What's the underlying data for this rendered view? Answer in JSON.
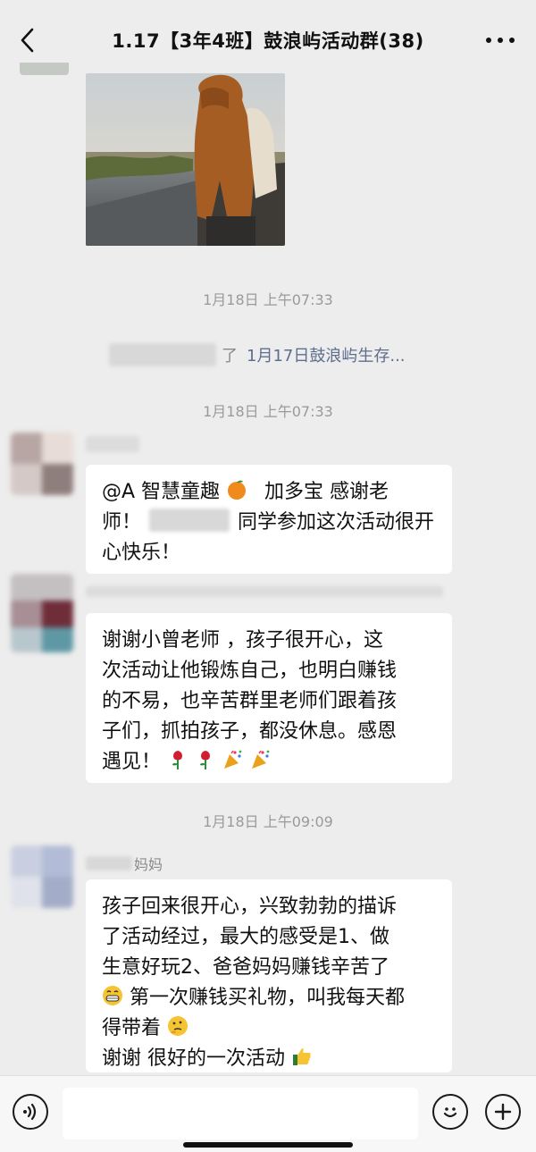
{
  "header": {
    "title": "1.17【3年4班】鼓浪屿活动群(38)"
  },
  "timestamps": [
    "1月18日  上午07:33",
    "1月18日  上午07:33",
    "1月18日  上午09:09"
  ],
  "system_message": {
    "text_visible": "了",
    "link_text": "1月17日鼓浪屿生存..."
  },
  "messages": [
    {
      "sender_visible": "",
      "lines": [
        "@A 智慧童趣",
        "加多宝  感谢老",
        "师！",
        "同学参加这次活动很开",
        "心快乐！"
      ],
      "emoji_after_first": "orange"
    },
    {
      "sender_visible": "",
      "lines": [
        "谢谢小曾老师 ，孩子很开心，这",
        "次活动让他锻炼自己，也明白赚钱",
        "的不易，也辛苦群里老师们跟着孩",
        "子们，抓拍孩子，都没休息。感恩",
        "遇见！"
      ],
      "emojis": [
        "rose",
        "rose",
        "party-popper",
        "party-popper"
      ]
    },
    {
      "sender_visible": "妈妈",
      "lines": [
        "孩子回来很开心，兴致勃勃的描诉",
        "了活动经过，最大的感受是1、做",
        "生意好玩2、爸爸妈妈赚钱辛苦了",
        "第一次赚钱买礼物，叫我每天都",
        "得带着",
        "谢谢  很好的一次活动"
      ],
      "emojis": [
        "grin",
        "thinking",
        "thumbs-up"
      ]
    }
  ],
  "colors": {
    "background": "#ededed",
    "bubble": "#ffffff",
    "link": "#5e6e8c",
    "timestamp": "#9a9a9a"
  }
}
